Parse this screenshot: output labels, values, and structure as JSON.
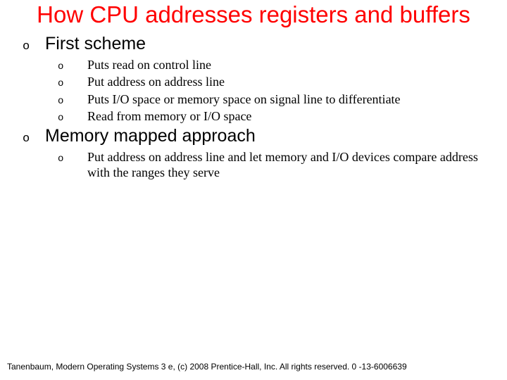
{
  "title": "How CPU addresses registers and buffers",
  "sections": [
    {
      "heading": "First scheme",
      "items": [
        "Puts read on control line",
        "Put address on address line",
        "Puts I/O space or memory space on signal line to differentiate",
        "Read from memory or I/O space"
      ]
    },
    {
      "heading": "Memory mapped approach",
      "items": [
        "Put address on address line and let memory and I/O devices compare address with the ranges they serve"
      ]
    }
  ],
  "footer": "Tanenbaum, Modern Operating Systems 3 e, (c) 2008 Prentice-Hall, Inc. All rights reserved. 0 -13-6006639",
  "bullet": "o"
}
